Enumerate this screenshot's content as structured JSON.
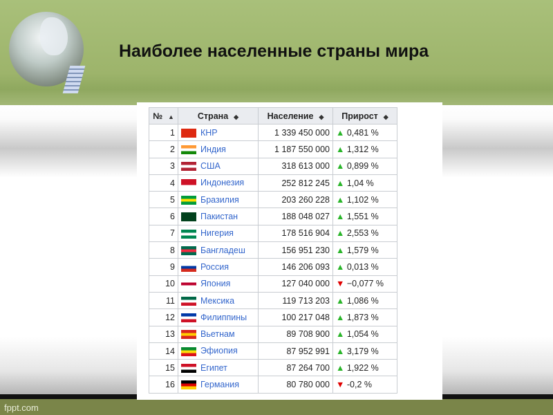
{
  "slide": {
    "title": "Наиболее населенные страны мира",
    "footer": "fppt.com"
  },
  "table": {
    "headers": [
      "№",
      "Страна",
      "Население",
      "Прирост"
    ],
    "rows": [
      {
        "n": "1",
        "country": "КНР",
        "pop": "1 339 450 000",
        "growth": "0,481 %",
        "dir": "up",
        "flag": [
          "#de2910",
          "#de2910",
          "#de2910"
        ]
      },
      {
        "n": "2",
        "country": "Индия",
        "pop": "1 187 550 000",
        "growth": "1,312 %",
        "dir": "up",
        "flag": [
          "#ff9933",
          "#ffffff",
          "#138808"
        ]
      },
      {
        "n": "3",
        "country": "США",
        "pop": "318 613 000",
        "growth": "0,899 %",
        "dir": "up",
        "flag": [
          "#b22234",
          "#ffffff",
          "#b22234"
        ]
      },
      {
        "n": "4",
        "country": "Индонезия",
        "pop": "252 812 245",
        "growth": "1,04 %",
        "dir": "up",
        "flag": [
          "#ce1126",
          "#ce1126",
          "#ffffff"
        ]
      },
      {
        "n": "5",
        "country": "Бразилия",
        "pop": "203 260 228",
        "growth": "1,102 %",
        "dir": "up",
        "flag": [
          "#009c3b",
          "#ffdf00",
          "#009c3b"
        ]
      },
      {
        "n": "6",
        "country": "Пакистан",
        "pop": "188 048 027",
        "growth": "1,551 %",
        "dir": "up",
        "flag": [
          "#01411c",
          "#01411c",
          "#01411c"
        ]
      },
      {
        "n": "7",
        "country": "Нигерия",
        "pop": "178 516 904",
        "growth": "2,553 %",
        "dir": "up",
        "flag": [
          "#008751",
          "#ffffff",
          "#008751"
        ]
      },
      {
        "n": "8",
        "country": "Бангладеш",
        "pop": "156 951 230",
        "growth": "1,579 %",
        "dir": "up",
        "flag": [
          "#006a4e",
          "#f42a41",
          "#006a4e"
        ]
      },
      {
        "n": "9",
        "country": "Россия",
        "pop": "146 206 093",
        "growth": "0,013 %",
        "dir": "up",
        "flag": [
          "#ffffff",
          "#0039a6",
          "#d52b1e"
        ]
      },
      {
        "n": "10",
        "country": "Япония",
        "pop": "127 040 000",
        "growth": "−0,077 %",
        "dir": "down",
        "flag": [
          "#ffffff",
          "#bc002d",
          "#ffffff"
        ]
      },
      {
        "n": "11",
        "country": "Мексика",
        "pop": "119 713 203",
        "growth": "1,086 %",
        "dir": "up",
        "flag": [
          "#006847",
          "#ffffff",
          "#ce1126"
        ]
      },
      {
        "n": "12",
        "country": "Филиппины",
        "pop": "100 217 048",
        "growth": "1,873 %",
        "dir": "up",
        "flag": [
          "#0038a8",
          "#ffffff",
          "#ce1126"
        ]
      },
      {
        "n": "13",
        "country": "Вьетнам",
        "pop": "89 708 900",
        "growth": "1,054 %",
        "dir": "up",
        "flag": [
          "#da251d",
          "#ffcd00",
          "#da251d"
        ]
      },
      {
        "n": "14",
        "country": "Эфиопия",
        "pop": "87 952 991",
        "growth": "3,179 %",
        "dir": "up",
        "flag": [
          "#078930",
          "#fcdd09",
          "#da121a"
        ]
      },
      {
        "n": "15",
        "country": "Египет",
        "pop": "87 264 700",
        "growth": "1,922 %",
        "dir": "up",
        "flag": [
          "#ce1126",
          "#ffffff",
          "#000000"
        ]
      },
      {
        "n": "16",
        "country": "Германия",
        "pop": "80 780 000",
        "growth": "-0,2 %",
        "dir": "down",
        "flag": [
          "#000000",
          "#dd0000",
          "#ffce00"
        ]
      }
    ]
  },
  "colors": {
    "up": "#2ab52a",
    "down": "#e00000",
    "link": "#3366cc",
    "footer_bg": "#7a8549"
  }
}
